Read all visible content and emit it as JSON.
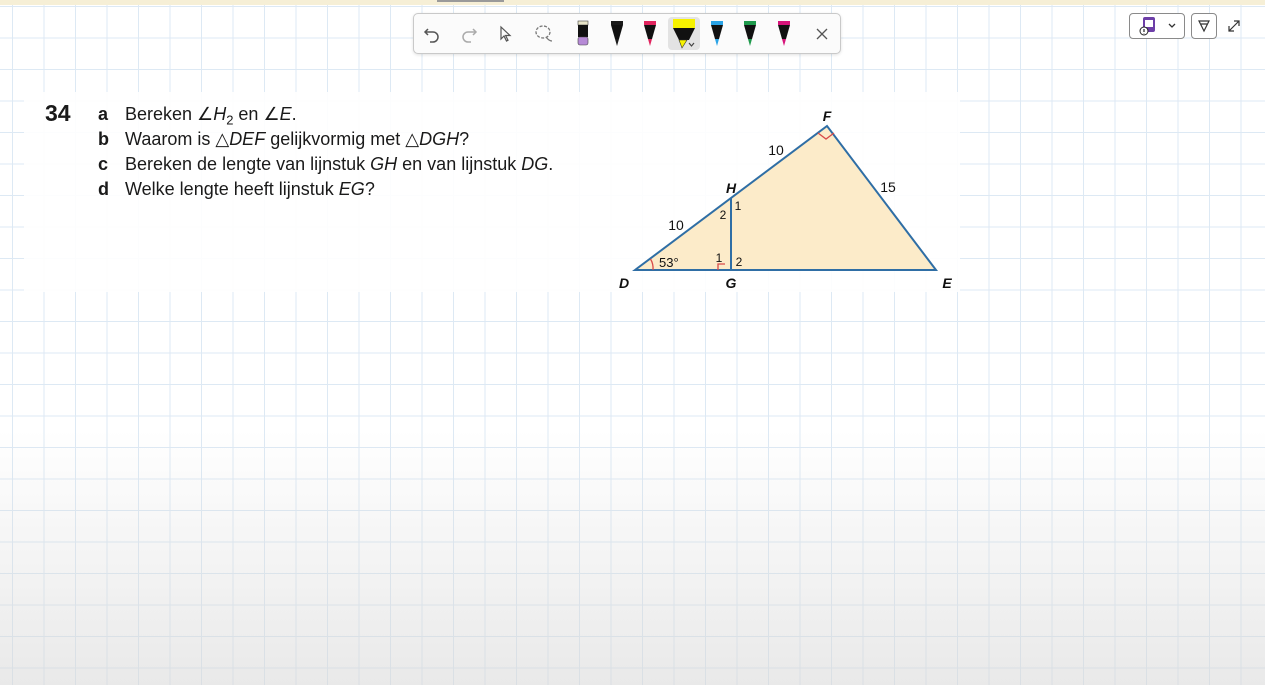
{
  "exercise": {
    "number": "34",
    "questions": [
      {
        "letter": "a",
        "p1": "Bereken ∠",
        "v1": "H",
        "sub1": "2",
        "p2": " en ∠",
        "v2": "E",
        "p3": "."
      },
      {
        "letter": "b",
        "p1": "Waarom is △",
        "v1": "DEF",
        "p2": " gelijkvormig met △",
        "v2": "DGH",
        "p3": "?"
      },
      {
        "letter": "c",
        "p1": "Bereken de lengte van lijnstuk ",
        "v1": "GH",
        "p2": " en van lijnstuk ",
        "v2": "DG",
        "p3": "."
      },
      {
        "letter": "d",
        "p1": "Welke lengte heeft lijnstuk ",
        "v1": "EG",
        "p2": "?"
      }
    ]
  },
  "figure": {
    "vertices": {
      "D": "D",
      "E": "E",
      "F": "F",
      "G": "G",
      "H": "H"
    },
    "lengths": {
      "DH": "10",
      "HF": "10",
      "FE": "15"
    },
    "angle_D": "53°",
    "angle_marks": {
      "H1": "1",
      "H2": "2",
      "G1": "1",
      "G2": "2"
    },
    "colors": {
      "fill": "#fcebc9",
      "stroke": "#2f6ea5",
      "angle": "#d84a4a"
    }
  },
  "toolbar": {
    "tools": [
      "undo-icon",
      "redo-icon",
      "select-icon",
      "lasso-icon",
      "pen-purple",
      "pen-black",
      "pen-red",
      "highlighter-yellow",
      "pen-blue",
      "pen-green",
      "pen-magenta",
      "close-icon"
    ],
    "pen_colors": {
      "purple": "#b68ad6",
      "black": "#1a1a1a",
      "red": "#e0245e",
      "yellow": "#f7f200",
      "blue": "#2aa3e6",
      "green": "#1f9a4c",
      "magenta": "#d6147a"
    }
  }
}
